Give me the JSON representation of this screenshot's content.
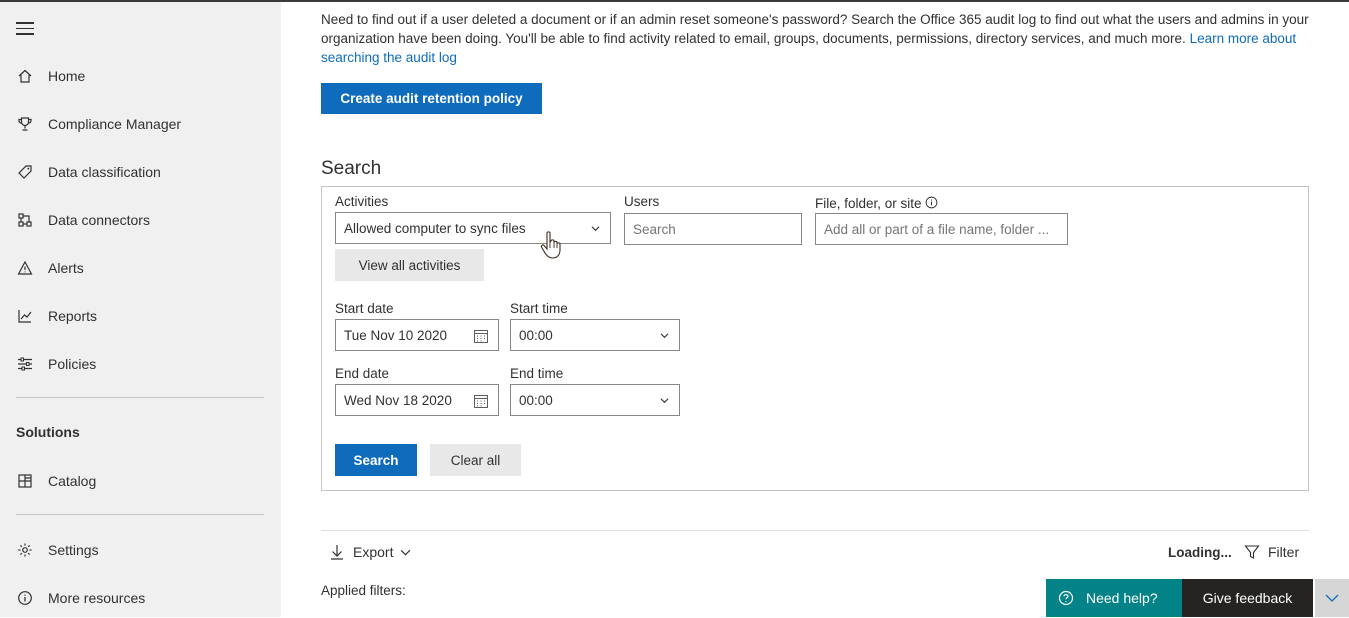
{
  "sidebar": {
    "items": [
      {
        "label": "Home",
        "icon": "home-icon"
      },
      {
        "label": "Compliance Manager",
        "icon": "trophy-icon"
      },
      {
        "label": "Data classification",
        "icon": "tag-icon"
      },
      {
        "label": "Data connectors",
        "icon": "connector-icon"
      },
      {
        "label": "Alerts",
        "icon": "warning-icon"
      },
      {
        "label": "Reports",
        "icon": "chart-icon"
      },
      {
        "label": "Policies",
        "icon": "sliders-icon"
      }
    ],
    "solutions_heading": "Solutions",
    "catalog_label": "Catalog",
    "settings_label": "Settings",
    "more_resources_label": "More resources"
  },
  "intro": {
    "text": "Need to find out if a user deleted a document or if an admin reset someone's password? Search the Office 365 audit log to find out what the users and admins in your organization have been doing. You'll be able to find activity related to email, groups, documents, permissions, directory services, and much more. ",
    "link": "Learn more about searching the audit log"
  },
  "create_policy_label": "Create audit retention policy",
  "search": {
    "heading": "Search",
    "activities_label": "Activities",
    "activities_value": "Allowed computer to sync files",
    "users_label": "Users",
    "users_placeholder": "Search",
    "file_label": "File, folder, or site",
    "file_placeholder": "Add all or part of a file name, folder ...",
    "view_all_label": "View all activities",
    "start_date_label": "Start date",
    "start_date_value": "Tue Nov 10 2020",
    "start_time_label": "Start time",
    "start_time_value": "00:00",
    "end_date_label": "End date",
    "end_date_value": "Wed Nov 18 2020",
    "end_time_label": "End time",
    "end_time_value": "00:00",
    "search_button": "Search",
    "clear_button": "Clear all"
  },
  "results": {
    "export_label": "Export",
    "loading_label": "Loading...",
    "filter_label": "Filter",
    "applied_filters_label": "Applied filters:"
  },
  "help": {
    "need_help_label": "Need help?",
    "feedback_label": "Give feedback"
  },
  "colors": {
    "accent": "#0f6cbd",
    "help_bg": "#038387",
    "feedback_bg": "#252423"
  }
}
